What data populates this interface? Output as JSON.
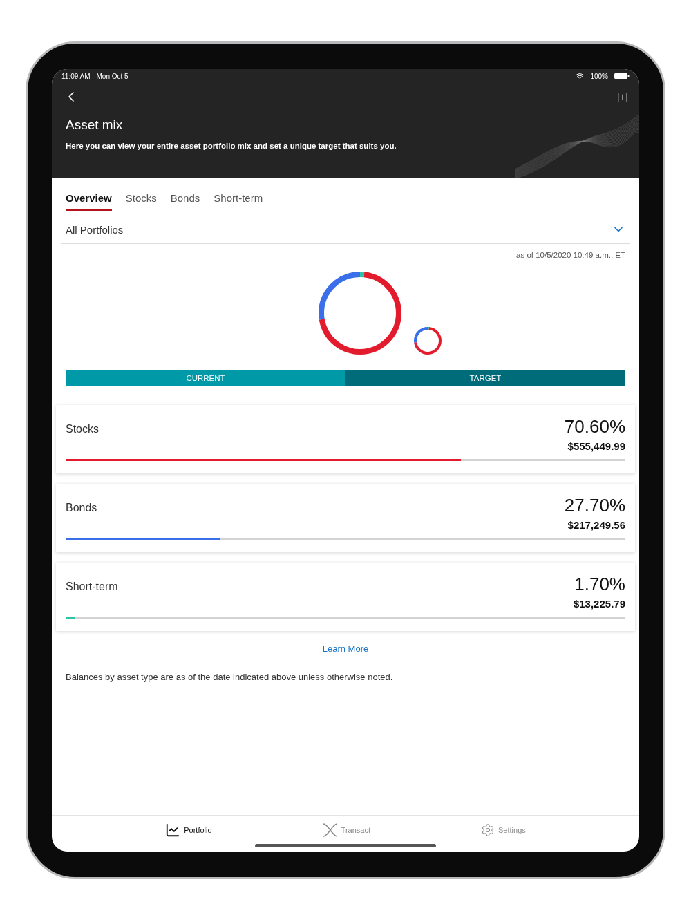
{
  "status_bar": {
    "time": "11:09 AM",
    "date": "Mon Oct 5",
    "battery": "100%"
  },
  "header": {
    "add_button": "[+]",
    "title": "Asset mix",
    "subtitle": "Here you can view your entire asset portfolio mix and set a unique target that suits you."
  },
  "tabs": [
    {
      "label": "Overview",
      "selected": true
    },
    {
      "label": "Stocks",
      "selected": false
    },
    {
      "label": "Bonds",
      "selected": false
    },
    {
      "label": "Short-term",
      "selected": false
    }
  ],
  "portfolio_select": {
    "value": "All Portfolios"
  },
  "as_of": "as of 10/5/2020 10:49 a.m., ET",
  "view_toggle": [
    {
      "label": "CURRENT",
      "selected": true
    },
    {
      "label": "TARGET",
      "selected": false
    }
  ],
  "assets": [
    {
      "name": "Stocks",
      "percent": "70.60%",
      "amount": "$555,449.99",
      "level": 0.706,
      "color": "#e31c2d"
    },
    {
      "name": "Bonds",
      "percent": "27.70%",
      "amount": "$217,249.56",
      "level": 0.277,
      "color": "#3b6fea"
    },
    {
      "name": "Short-term",
      "percent": "1.70%",
      "amount": "$13,225.79",
      "level": 0.017,
      "color": "#2ec4a6"
    }
  ],
  "learn_more": "Learn More",
  "note": "Balances by asset type are as of the date indicated above unless otherwise noted.",
  "bottom_nav": [
    {
      "label": "Portfolio",
      "kind": "chart",
      "selected": true
    },
    {
      "label": "Transact",
      "kind": "cross",
      "selected": false
    },
    {
      "label": "Settings",
      "kind": "gear",
      "selected": false
    }
  ]
}
